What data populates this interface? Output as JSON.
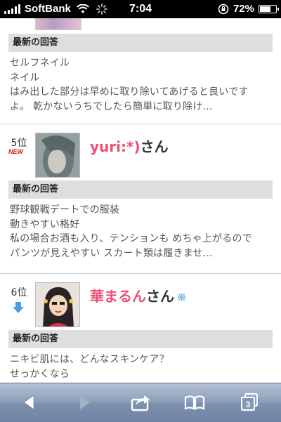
{
  "status": {
    "carrier": "SoftBank",
    "time": "7:04",
    "battery_label": "72%",
    "battery_level": 0.72
  },
  "entries": [
    {
      "section_label": "最新の回答",
      "lines": [
        "セルフネイル",
        "ネイル",
        "はみ出した部分は早めに取り除いてあげると良いです",
        "よ。 乾かないうちでしたら簡単に取り除け…"
      ]
    },
    {
      "rank": "5位",
      "badge": "NEW",
      "user": "yuri:*)",
      "suffix": "さん",
      "section_label": "最新の回答",
      "lines": [
        "野球観戦デートでの服装",
        "動きやすい格好",
        "私の場合お酒も入り、テンションも めちゃ上がるので",
        "パンツが見えやすい スカート類は履きませ…"
      ]
    },
    {
      "rank": "6位",
      "user": "華まるん",
      "suffix": "さん",
      "mark": "❋",
      "section_label": "最新の回答",
      "lines": [
        "ニキビ肌には、どんなスキンケア？",
        "せっかくなら"
      ]
    }
  ],
  "toolbar": {
    "tab_count": "3"
  },
  "colors": {
    "username": "#ee4f74",
    "new_badge": "#d21a1a",
    "arrow": "#4a9fe0"
  }
}
